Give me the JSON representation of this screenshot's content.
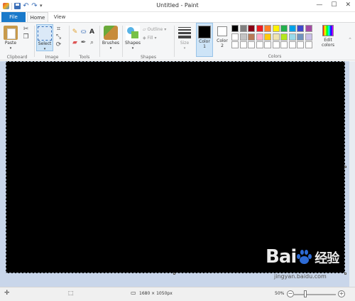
{
  "window": {
    "title": "Untitled - Paint",
    "controls": {
      "minimize": "—",
      "maximize": "☐",
      "close": "✕"
    }
  },
  "quick_access": {
    "menu_glyph": "▾"
  },
  "tabs": [
    {
      "label": "File",
      "active": false
    },
    {
      "label": "Home",
      "active": true
    },
    {
      "label": "View",
      "active": false
    }
  ],
  "ribbon": {
    "clipboard": {
      "paste_label": "Paste",
      "group_label": "Clipboard"
    },
    "image": {
      "select_label": "Select",
      "group_label": "Image"
    },
    "tools": {
      "group_label": "Tools",
      "text_tool": "A"
    },
    "brushes": {
      "label": "Brushes"
    },
    "shapes": {
      "label": "Shapes",
      "outline_label": "Outline",
      "fill_label": "Fill",
      "group_label": "Shapes"
    },
    "size": {
      "label": "Size"
    },
    "colors": {
      "color1_label": "Color",
      "color1_num": "1",
      "color2_label": "Color",
      "color2_num": "2",
      "edit_label": "Edit",
      "edit_label2": "colors",
      "group_label": "Colors",
      "color1_value": "#000000",
      "color2_value": "#ffffff",
      "palette": [
        "#000000",
        "#7f7f7f",
        "#880015",
        "#ed1c24",
        "#ff7f27",
        "#fff200",
        "#22b14c",
        "#00a2e8",
        "#3f48cc",
        "#a349a4",
        "#ffffff",
        "#c3c3c3",
        "#b97a57",
        "#ffaec9",
        "#ffc90e",
        "#efe4b0",
        "#b5e61d",
        "#99d9ea",
        "#7092be",
        "#c8bfe7",
        "#ffffff",
        "#ffffff",
        "#ffffff",
        "#ffffff",
        "#ffffff",
        "#ffffff",
        "#ffffff",
        "#ffffff",
        "#ffffff",
        "#ffffff"
      ]
    }
  },
  "canvas": {
    "fill_color": "#000000"
  },
  "watermark": {
    "text_left": "Bai",
    "text_right": "经验",
    "url": "jingyan.baidu.com"
  },
  "statusbar": {
    "dimensions": "1680 × 1050px",
    "zoom": "50%"
  }
}
